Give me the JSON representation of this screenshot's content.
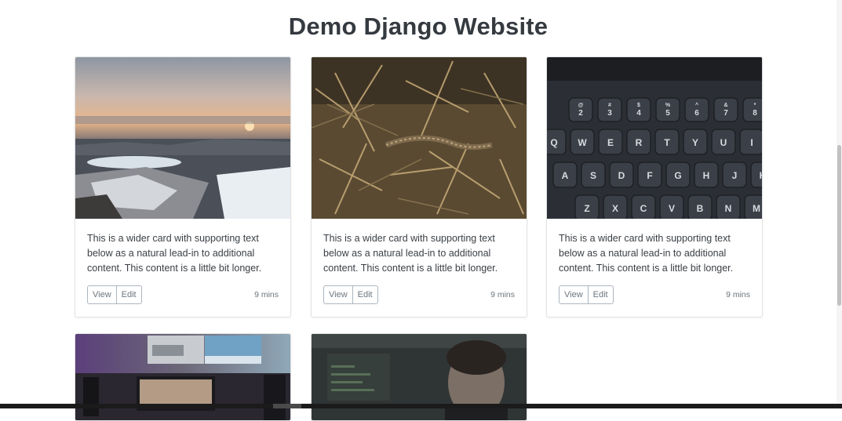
{
  "page": {
    "title": "Demo Django Website"
  },
  "cards": [
    {
      "image": "snowy-coastal-town-sunset",
      "text": "This is a wider card with supporting text below as a natural lead-in to additional content. This content is a little bit longer.",
      "view_label": "View",
      "edit_label": "Edit",
      "time": "9 mins"
    },
    {
      "image": "lizard-in-dry-grass",
      "text": "This is a wider card with supporting text below as a natural lead-in to additional content. This content is a little bit longer.",
      "view_label": "View",
      "edit_label": "Edit",
      "time": "9 mins"
    },
    {
      "image": "keyboard-closeup",
      "text": "This is a wider card with supporting text below as a natural lead-in to additional content. This content is a little bit longer.",
      "view_label": "View",
      "edit_label": "Edit",
      "time": "9 mins"
    },
    {
      "image": "desk-setup-monitors"
    },
    {
      "image": "person-dark-office"
    }
  ],
  "keyboard_keys": {
    "row1": [
      "@ 2",
      "# 3",
      "$ 4",
      "% 5",
      "^ 6",
      "& 7",
      "* 8"
    ],
    "row2": [
      "Q",
      "W",
      "E",
      "R",
      "T",
      "Y",
      "U",
      "I"
    ],
    "row3": [
      "A",
      "S",
      "D",
      "F",
      "G",
      "H",
      "J",
      "K"
    ],
    "row4": [
      "Z",
      "X",
      "C",
      "V",
      "B",
      "N",
      "M"
    ]
  }
}
